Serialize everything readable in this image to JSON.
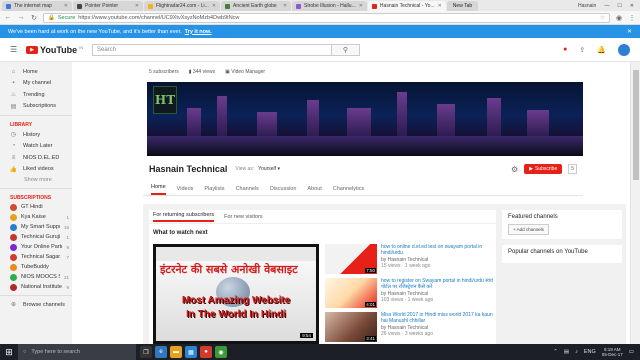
{
  "browser": {
    "tabs": [
      {
        "label": "The internet map",
        "color": "#3b7bd4",
        "active": false
      },
      {
        "label": "Pointer Pointer",
        "color": "#444444",
        "active": false
      },
      {
        "label": "Flightradar24.com - Li...",
        "color": "#f2b21b",
        "active": false
      },
      {
        "label": "Ancient Earth globe",
        "color": "#4b7d3a",
        "active": false
      },
      {
        "label": "Strobe Illusion - Hallu...",
        "color": "#8f5ad1",
        "active": false
      },
      {
        "label": "Hasnain Technical - Yo...",
        "color": "#e62117",
        "active": true
      },
      {
        "label": "New Tab",
        "color": "#bbbbbb",
        "active": false
      }
    ],
    "window_user": "Hasnain",
    "secure_label": "Secure",
    "url": "https://www.youtube.com/channel/UC9XtvXsyzNoMzb4Dwb9tNcw"
  },
  "notice": {
    "text": "We've been hard at work on the new YouTube, and it's better than ever.",
    "link": "Try it now.",
    "close": "✕"
  },
  "masthead": {
    "logo_word": "YouTube",
    "logo_region": "IN",
    "search_placeholder": "Search",
    "search_icon": "⚲"
  },
  "sidebar": {
    "main": [
      {
        "label": "Home",
        "icon": "⌂",
        "active": false
      },
      {
        "label": "My channel",
        "icon": "▪",
        "active": false
      },
      {
        "label": "Trending",
        "icon": "♨",
        "active": false
      },
      {
        "label": "Subscriptions",
        "icon": "▤",
        "active": false
      }
    ],
    "library_heading": "LIBRARY",
    "library": [
      {
        "label": "History",
        "icon": "◷"
      },
      {
        "label": "Watch Later",
        "icon": "◔"
      },
      {
        "label": "NIOS D.EL.ED",
        "icon": "≡"
      },
      {
        "label": "Liked videos",
        "icon": "👍"
      }
    ],
    "show_more": "Show more",
    "subs_heading": "SUBSCRIPTIONS",
    "subscriptions": [
      {
        "name": "GT Hindi",
        "count": "",
        "color": "#d24b2a"
      },
      {
        "name": "Kya Kaise",
        "count": "1",
        "color": "#e6a21a"
      },
      {
        "name": "My Smart Support",
        "count": "16",
        "color": "#2a7bd2"
      },
      {
        "name": "Technical Guruji",
        "count": "1",
        "color": "#c0392b"
      },
      {
        "name": "Your Online Partn...",
        "count": "9",
        "color": "#7a2ad2"
      },
      {
        "name": "Technical Sagar",
        "count": "7",
        "color": "#d23a2a"
      },
      {
        "name": "TubeBuddy",
        "count": "",
        "color": "#e68a1a"
      },
      {
        "name": "NIOS MOOCS Sr...",
        "count": "21",
        "color": "#2ab04b"
      },
      {
        "name": "National Institute...",
        "count": "9",
        "color": "#b02a2a"
      }
    ],
    "browse_channels": "Browse channels"
  },
  "channel": {
    "subscribers_text": "5 subscribers",
    "views_text": "344 views",
    "video_manager": "Video Manager",
    "avatar_text": "HT",
    "title": "Hasnain Technical",
    "view_as_label": "View as:",
    "view_as_value": "Yourself ▾",
    "subscribe_label": "Subscribe",
    "subscribe_count": "5",
    "tabs": [
      "Home",
      "Videos",
      "Playlists",
      "Channels",
      "Discussion",
      "About",
      "Channelytics"
    ]
  },
  "content": {
    "subtabs": [
      "For returning subscribers",
      "For new visitors"
    ],
    "section_title": "What to watch next",
    "featured": {
      "hindi_text": "इंटरनेट की सबसे अनोखी वेबसाइट",
      "title_line1": "Most Amazing Website",
      "title_line2": "In The World In Hindi",
      "duration": "9:54"
    },
    "videos": [
      {
        "title": "how to online d.el.ed test on swayam portal in hindi/urdu",
        "by": "by Hasnain Technical",
        "meta": "15 views · 1 week ago",
        "duration": "7:50"
      },
      {
        "title": "how to register on Swayam portal in hindi/urdu स्वयं पोर्टल पर रजिस्ट्रेशन कैसे करें",
        "by": "by Hasnain Technical",
        "meta": "103 views · 1 week ago",
        "duration": "4:01"
      },
      {
        "title": "Miss World 2017 in Hindi miss world 2017 ka kaun hai Manushi chhillar",
        "by": "by Hasnain Technical",
        "meta": "26 views · 3 weeks ago",
        "duration": "3:41"
      }
    ]
  },
  "rightcol": {
    "featured_title": "Featured channels",
    "add_channels": "+ Add channels",
    "popular_title": "Popular channels on YouTube"
  },
  "taskbar": {
    "search_placeholder": "Type here to search",
    "lang": "ENG",
    "time": "9:19 AM",
    "date": "05-Dec-17"
  }
}
